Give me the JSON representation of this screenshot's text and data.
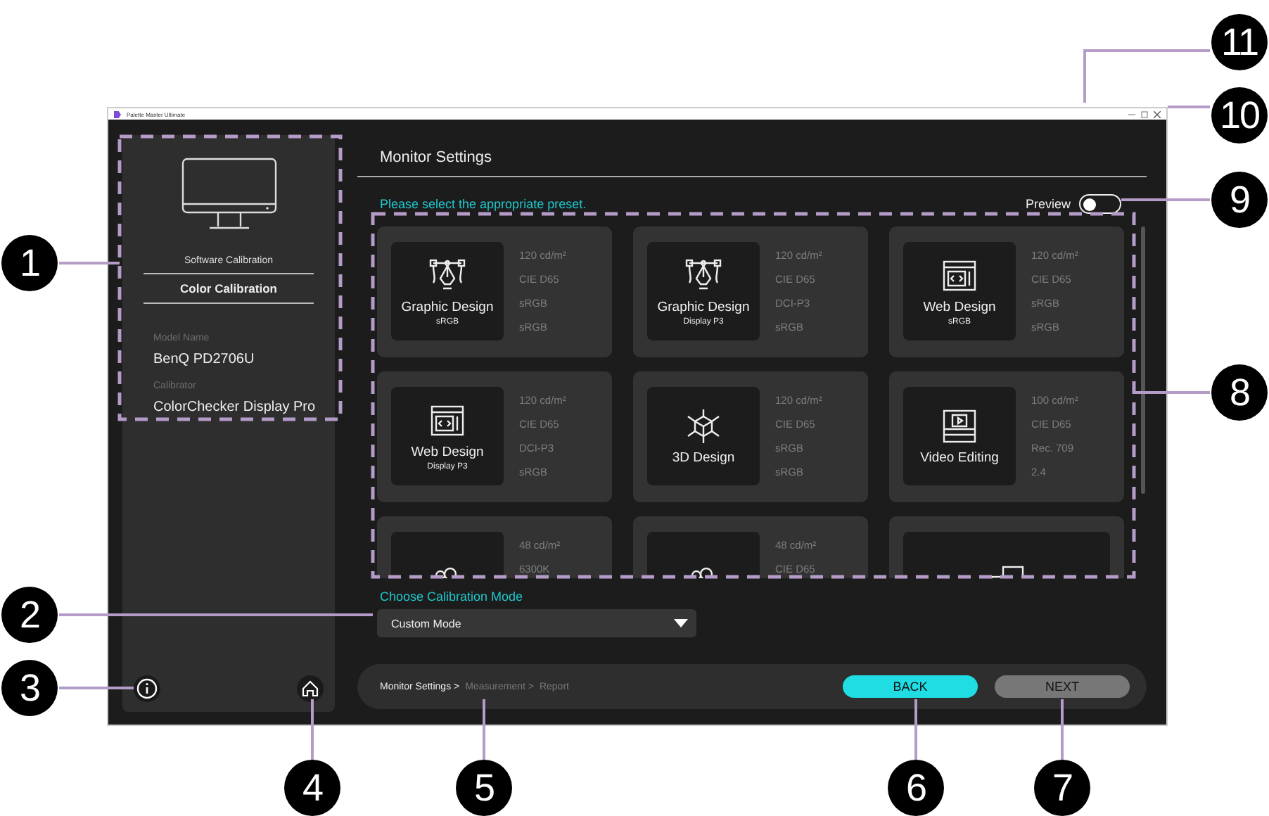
{
  "window": {
    "title": "Palette Master Ultimate"
  },
  "sidebar": {
    "mode_label": "Software Calibration",
    "mode_title": "Color Calibration",
    "model_label": "Model Name",
    "model_value": "BenQ PD2706U",
    "calibrator_label": "Calibrator",
    "calibrator_value": "ColorChecker Display Pro"
  },
  "header": {
    "title": "Monitor Settings",
    "prompt": "Please select the appropriate preset.",
    "preview": {
      "label": "Preview",
      "on": false
    }
  },
  "presets": [
    {
      "kind": "pen",
      "title": "Graphic Design",
      "subtitle": "sRGB",
      "specs": [
        "120 cd/m²",
        "CIE D65",
        "sRGB",
        "sRGB"
      ]
    },
    {
      "kind": "pen",
      "title": "Graphic Design",
      "subtitle": "Display P3",
      "specs": [
        "120 cd/m²",
        "CIE D65",
        "DCI-P3",
        "sRGB"
      ]
    },
    {
      "kind": "web",
      "title": "Web Design",
      "subtitle": "sRGB",
      "specs": [
        "120 cd/m²",
        "CIE D65",
        "sRGB",
        "sRGB"
      ]
    },
    {
      "kind": "web",
      "title": "Web Design",
      "subtitle": "Display P3",
      "specs": [
        "120 cd/m²",
        "CIE D65",
        "DCI-P3",
        "sRGB"
      ]
    },
    {
      "kind": "cube",
      "title": "3D Design",
      "specs": [
        "120 cd/m²",
        "CIE D65",
        "sRGB",
        "sRGB"
      ]
    },
    {
      "kind": "video",
      "title": "Video Editing",
      "specs": [
        "100 cd/m²",
        "CIE D65",
        "Rec. 709",
        "2.4"
      ]
    },
    {
      "kind": "camera",
      "specs": [
        "48 cd/m²",
        "6300K"
      ]
    },
    {
      "kind": "camera",
      "specs": [
        "48 cd/m²",
        "CIE D65"
      ]
    },
    {
      "kind": "screens"
    }
  ],
  "calibration_mode": {
    "label": "Choose Calibration Mode",
    "value": "Custom Mode"
  },
  "breadcrumb": [
    {
      "label": "Monitor Settings >",
      "selected": true
    },
    {
      "label": "Measurement >",
      "selected": false
    },
    {
      "label": "Report",
      "selected": false
    }
  ],
  "buttons": [
    {
      "label": "BACK",
      "disabled": false
    },
    {
      "label": "NEXT",
      "disabled": true
    }
  ],
  "callouts": [
    "11",
    "10",
    "9",
    "1",
    "8",
    "2",
    "3",
    "4",
    "5",
    "6",
    "7"
  ]
}
